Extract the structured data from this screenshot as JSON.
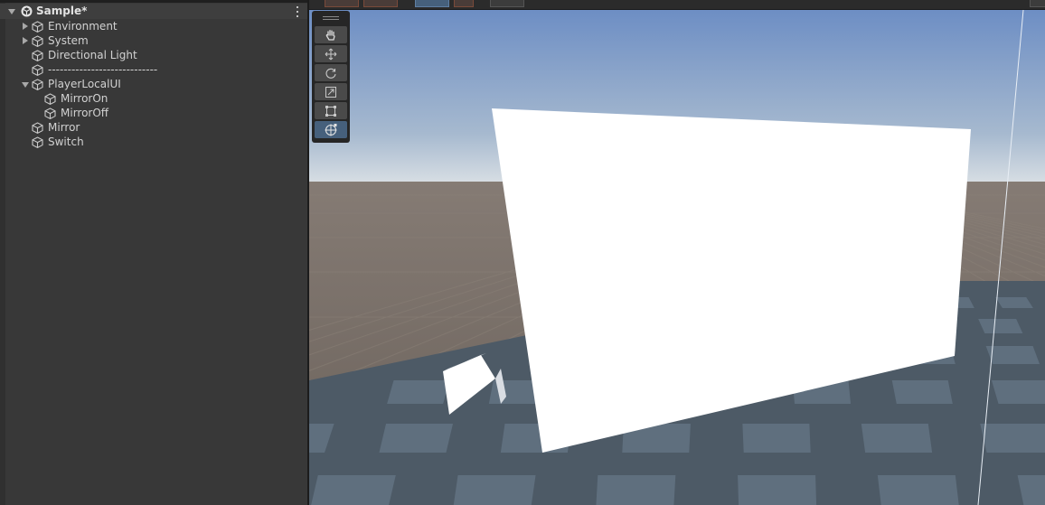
{
  "hierarchy": {
    "scene": {
      "name": "Sample*",
      "expanded": true
    },
    "items": [
      {
        "label": "Environment",
        "depth": 0,
        "foldout": "collapsed"
      },
      {
        "label": "System",
        "depth": 0,
        "foldout": "collapsed"
      },
      {
        "label": "Directional Light",
        "depth": 0,
        "foldout": "none"
      },
      {
        "label": "----------------------------",
        "depth": 0,
        "foldout": "none"
      },
      {
        "label": "PlayerLocalUI",
        "depth": 0,
        "foldout": "expanded"
      },
      {
        "label": "MirrorOn",
        "depth": 1,
        "foldout": "none"
      },
      {
        "label": "MirrorOff",
        "depth": 1,
        "foldout": "none"
      },
      {
        "label": "Mirror",
        "depth": 0,
        "foldout": "none"
      },
      {
        "label": "Switch",
        "depth": 0,
        "foldout": "none"
      }
    ]
  },
  "scene_tools": {
    "items": [
      {
        "name": "view-tool",
        "icon": "hand-icon",
        "active": false
      },
      {
        "name": "move-tool",
        "icon": "move-arrows-icon",
        "active": false
      },
      {
        "name": "rotate-tool",
        "icon": "rotate-icon",
        "active": false
      },
      {
        "name": "scale-tool",
        "icon": "scale-icon",
        "active": false
      },
      {
        "name": "rect-tool",
        "icon": "rect-icon",
        "active": false
      },
      {
        "name": "transform-tool",
        "icon": "transform-icon",
        "active": true
      }
    ]
  },
  "colors": {
    "panel_bg": "#383838",
    "sky_top": "#6d8ec4",
    "horizon": "#d6dde3",
    "ground": "#6a615a",
    "floor": "#4d5a66",
    "active_tool": "#46607c"
  }
}
